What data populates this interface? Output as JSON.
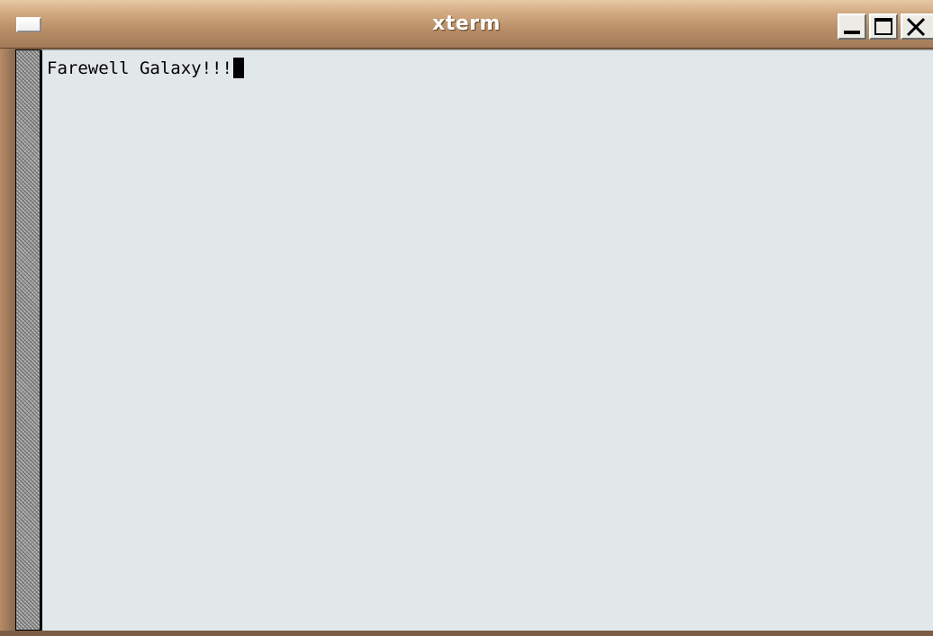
{
  "window": {
    "title": "xterm",
    "controls": {
      "menu_icon": "window-menu-icon",
      "minimize_icon": "minimize-icon",
      "maximize_icon": "maximize-icon",
      "close_icon": "close-icon"
    }
  },
  "terminal": {
    "lines": [
      "Farewell Galaxy!!!"
    ],
    "cursor": "block",
    "colors": {
      "background": "#e2e7ea",
      "foreground": "#000000"
    }
  },
  "titlebar_colors": {
    "top": "#e8c9a6",
    "bottom": "#a27b58"
  }
}
